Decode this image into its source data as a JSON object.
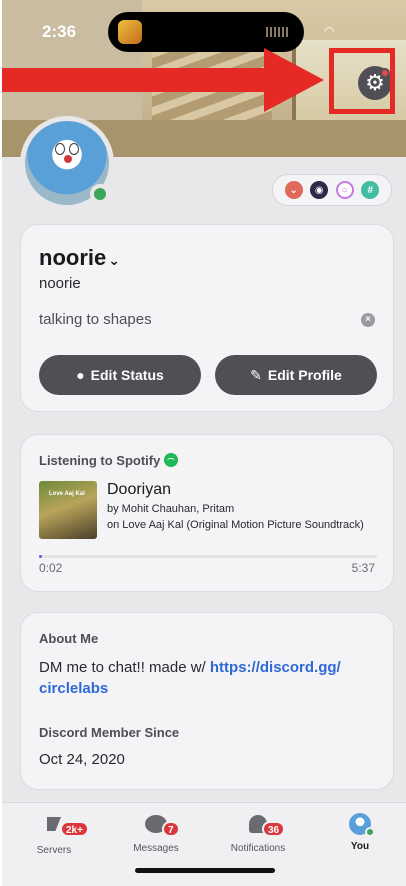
{
  "status_bar": {
    "time": "2:36"
  },
  "profile": {
    "display_name": "noorie",
    "username": "noorie",
    "custom_status": "talking to shapes",
    "edit_status_label": "Edit Status",
    "edit_profile_label": "Edit Profile",
    "online_status_color": "#3ba55c"
  },
  "badges": [
    "hypesquad-badge",
    "speed-badge",
    "nitro-badge",
    "hashtag-badge"
  ],
  "spotify": {
    "heading": "Listening to Spotify",
    "album_art_text": "Love Aaj Kal",
    "song": "Dooriyan",
    "artist_line": "by Mohit Chauhan,  Pritam",
    "album_line": "on Love Aaj Kal (Original Motion Picture Soundtrack)",
    "elapsed": "0:02",
    "duration": "5:37",
    "progress_fraction": 0.006
  },
  "about": {
    "heading": "About Me",
    "text_prefix": "DM me to chat!! made w/ ",
    "link": "https://discord.gg/circlelabs",
    "link_display_1": "https://discord.gg/",
    "link_display_2": "circlelabs",
    "member_since_heading": "Discord Member Since",
    "member_since": "Oct 24, 2020"
  },
  "tabbar": {
    "servers": {
      "label": "Servers",
      "count": "2k+"
    },
    "messages": {
      "label": "Messages",
      "count": "7"
    },
    "notifications": {
      "label": "Notifications",
      "count": "36"
    },
    "you": {
      "label": "You"
    }
  },
  "colors": {
    "annotation": "#e52a25",
    "accent_link": "#2e69d6",
    "button": "#4f4f55",
    "badge_red": "#da373c"
  }
}
